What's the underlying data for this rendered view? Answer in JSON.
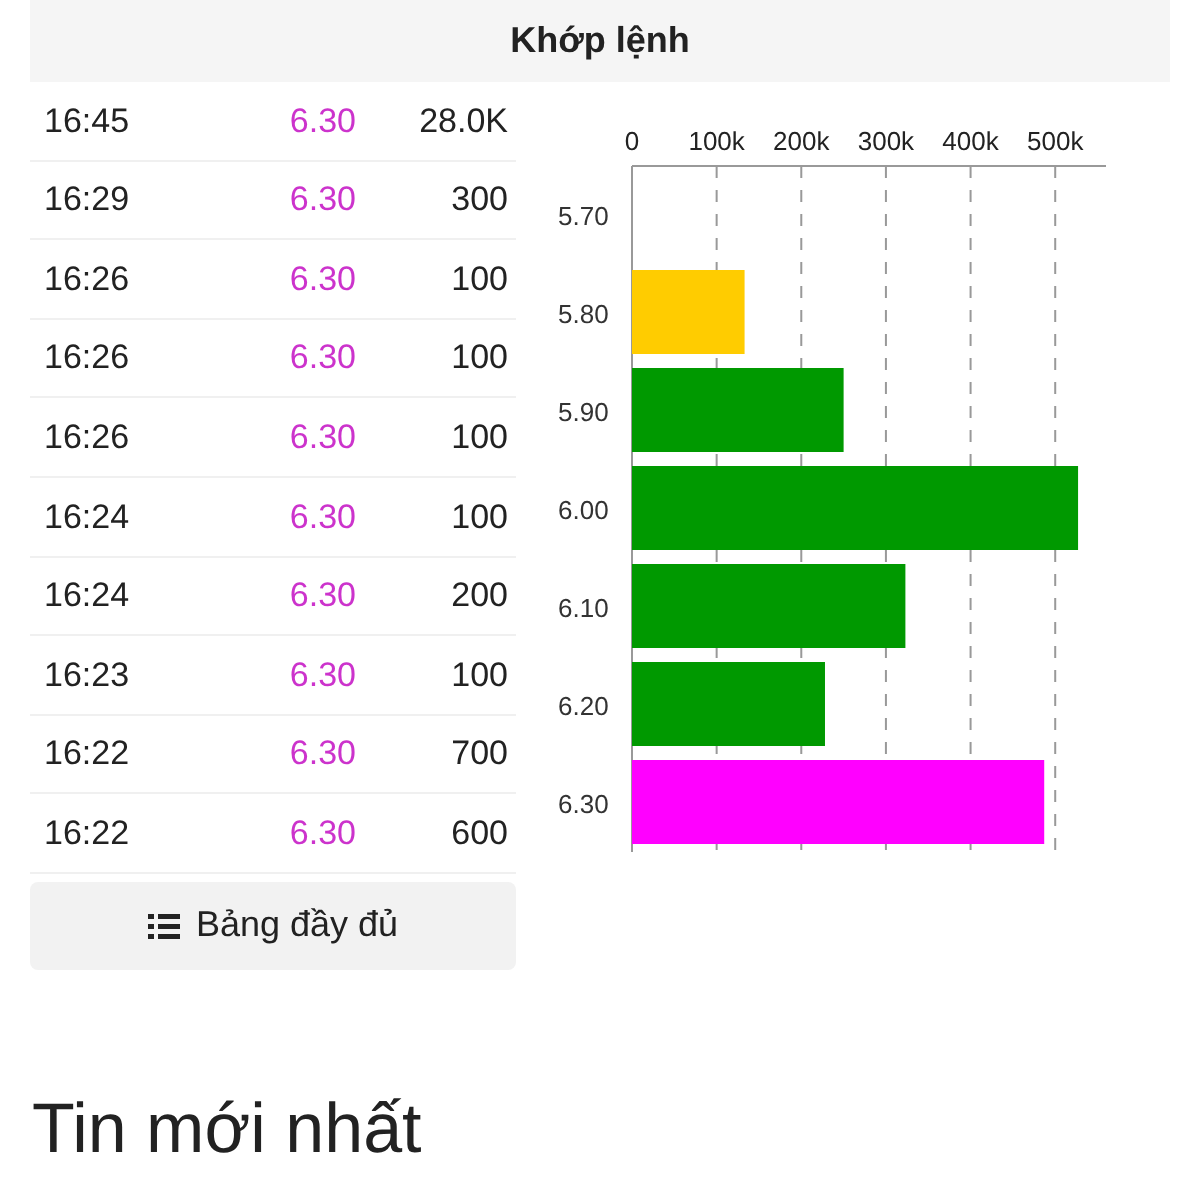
{
  "header": {
    "title": "Khớp lệnh"
  },
  "trades": [
    {
      "time": "16:45",
      "price": "6.30",
      "volume": "28.0K"
    },
    {
      "time": "16:29",
      "price": "6.30",
      "volume": "300"
    },
    {
      "time": "16:26",
      "price": "6.30",
      "volume": "100"
    },
    {
      "time": "16:26",
      "price": "6.30",
      "volume": "100"
    },
    {
      "time": "16:26",
      "price": "6.30",
      "volume": "100"
    },
    {
      "time": "16:24",
      "price": "6.30",
      "volume": "100"
    },
    {
      "time": "16:24",
      "price": "6.30",
      "volume": "200"
    },
    {
      "time": "16:23",
      "price": "6.30",
      "volume": "100"
    },
    {
      "time": "16:22",
      "price": "6.30",
      "volume": "700"
    },
    {
      "time": "16:22",
      "price": "6.30",
      "volume": "600"
    }
  ],
  "full_table_button": {
    "label": "Bảng đầy đủ"
  },
  "chart": {
    "chart_data": {
      "type": "bar",
      "orientation": "horizontal",
      "categories": [
        "5.70",
        "5.80",
        "5.90",
        "6.00",
        "6.10",
        "6.20",
        "6.30"
      ],
      "grid": true,
      "xlim": [
        0,
        560000
      ],
      "xticks": [
        {
          "value": 0,
          "label": "0"
        },
        {
          "value": 100000,
          "label": "100k"
        },
        {
          "value": 200000,
          "label": "200k"
        },
        {
          "value": 300000,
          "label": "300k"
        },
        {
          "value": 400000,
          "label": "400k"
        },
        {
          "value": 500000,
          "label": "500k"
        }
      ],
      "series": [
        {
          "color": "#ffcc00",
          "values": [
            null,
            133000,
            null,
            null,
            null,
            null,
            null
          ]
        },
        {
          "color": "#009900",
          "values": [
            null,
            null,
            250000,
            527000,
            323000,
            228000,
            null
          ]
        },
        {
          "color": "#ff00ff",
          "values": [
            null,
            null,
            null,
            null,
            null,
            null,
            487000
          ]
        }
      ]
    }
  },
  "news": {
    "title": "Tin mới nhất"
  }
}
